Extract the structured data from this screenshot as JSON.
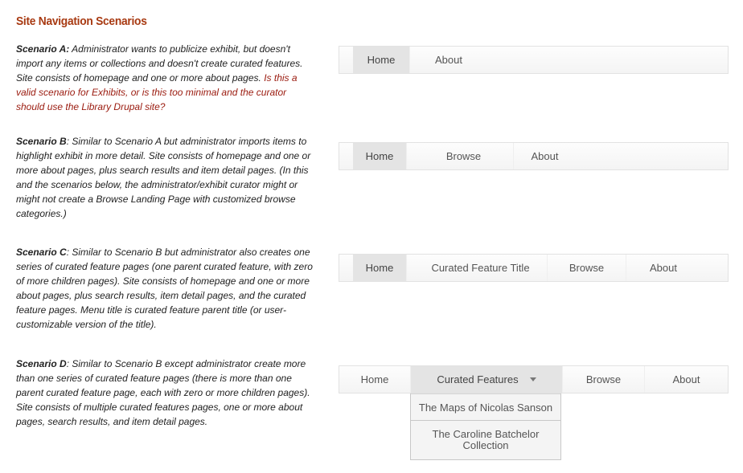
{
  "title": "Site Navigation Scenarios",
  "scenarios": [
    {
      "label": "Scenario A:",
      "text": " Administrator wants to publicize exhibit, but doesn't import any items or collections and doesn't create curated features. Site consists of homepage and one or more about pages. ",
      "question": "Is this a valid scenario for Exhibits, or is this too minimal and the curator should use the Library Drupal site?",
      "nav": [
        "Home",
        "About"
      ]
    },
    {
      "label": "Scenario B",
      "text": ": Similar to Scenario A but administrator imports items to highlight exhibit in more detail. Site consists of homepage and one or more about pages, plus search results and item detail pages. (In this and the scenarios below, the administrator/exhibit curator might or might not create a Browse Landing Page with customized browse categories.)",
      "nav": [
        "Home",
        "Browse",
        "About"
      ]
    },
    {
      "label": "Scenario C",
      "text": ": Similar to Scenario B but administrator also creates one series of curated feature pages (one parent curated feature, with zero of more children pages). Site consists of homepage and one or more about pages, plus search results, item detail pages, and the curated feature pages. Menu title is curated feature parent title (or user-customizable version of the title).",
      "nav": [
        "Home",
        "Curated Feature Title",
        "Browse",
        "About"
      ]
    },
    {
      "label": "Scenario D",
      "text": ": Similar to Scenario B except administrator create more than one series of curated feature pages (there is more than one parent curated feature page, each with zero or more children pages). Site consists of multiple curated features pages, one or more about pages, search results, and item detail pages.",
      "nav": [
        "Home",
        "Curated Features",
        "Browse",
        "About"
      ],
      "dropdown": [
        "The Maps of Nicolas Sanson",
        "The Caroline Batchelor Collection"
      ]
    }
  ],
  "colors": {
    "title": "#a83a12",
    "question": "#9a1a0e",
    "active_tab": "#e4e4e4"
  }
}
